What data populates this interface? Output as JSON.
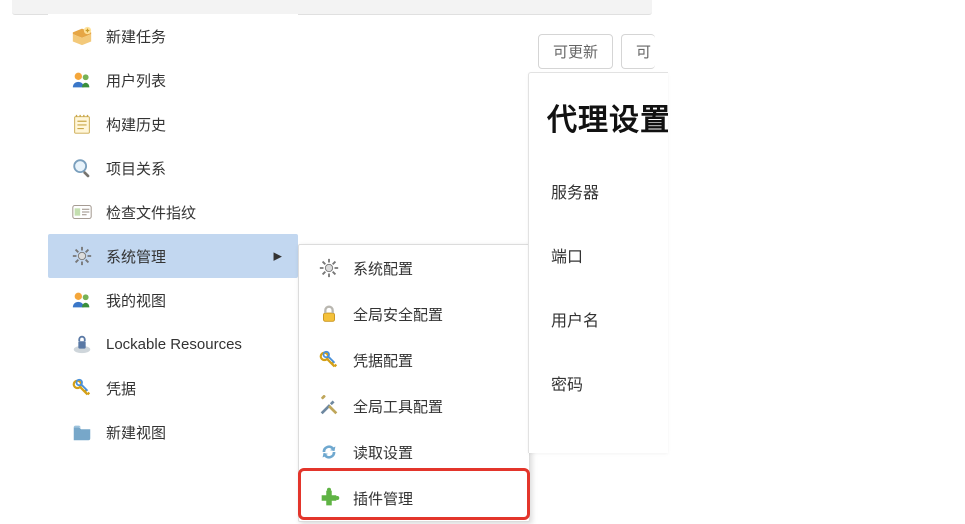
{
  "sidebar": {
    "items": [
      {
        "label": "新建任务"
      },
      {
        "label": "用户列表"
      },
      {
        "label": "构建历史"
      },
      {
        "label": "项目关系"
      },
      {
        "label": "检查文件指纹"
      },
      {
        "label": "系统管理"
      },
      {
        "label": "我的视图"
      },
      {
        "label": "Lockable Resources"
      },
      {
        "label": "凭据"
      },
      {
        "label": "新建视图"
      }
    ]
  },
  "submenu": {
    "items": [
      {
        "label": "系统配置"
      },
      {
        "label": "全局安全配置"
      },
      {
        "label": "凭据配置"
      },
      {
        "label": "全局工具配置"
      },
      {
        "label": "读取设置"
      },
      {
        "label": "插件管理"
      }
    ]
  },
  "tabs": {
    "updatable": "可更新",
    "next_partial": "可"
  },
  "panel": {
    "title_partial": "代理设置",
    "fields": {
      "server": "服务器",
      "port": "端口",
      "user": "用户名",
      "password": "密码"
    }
  }
}
